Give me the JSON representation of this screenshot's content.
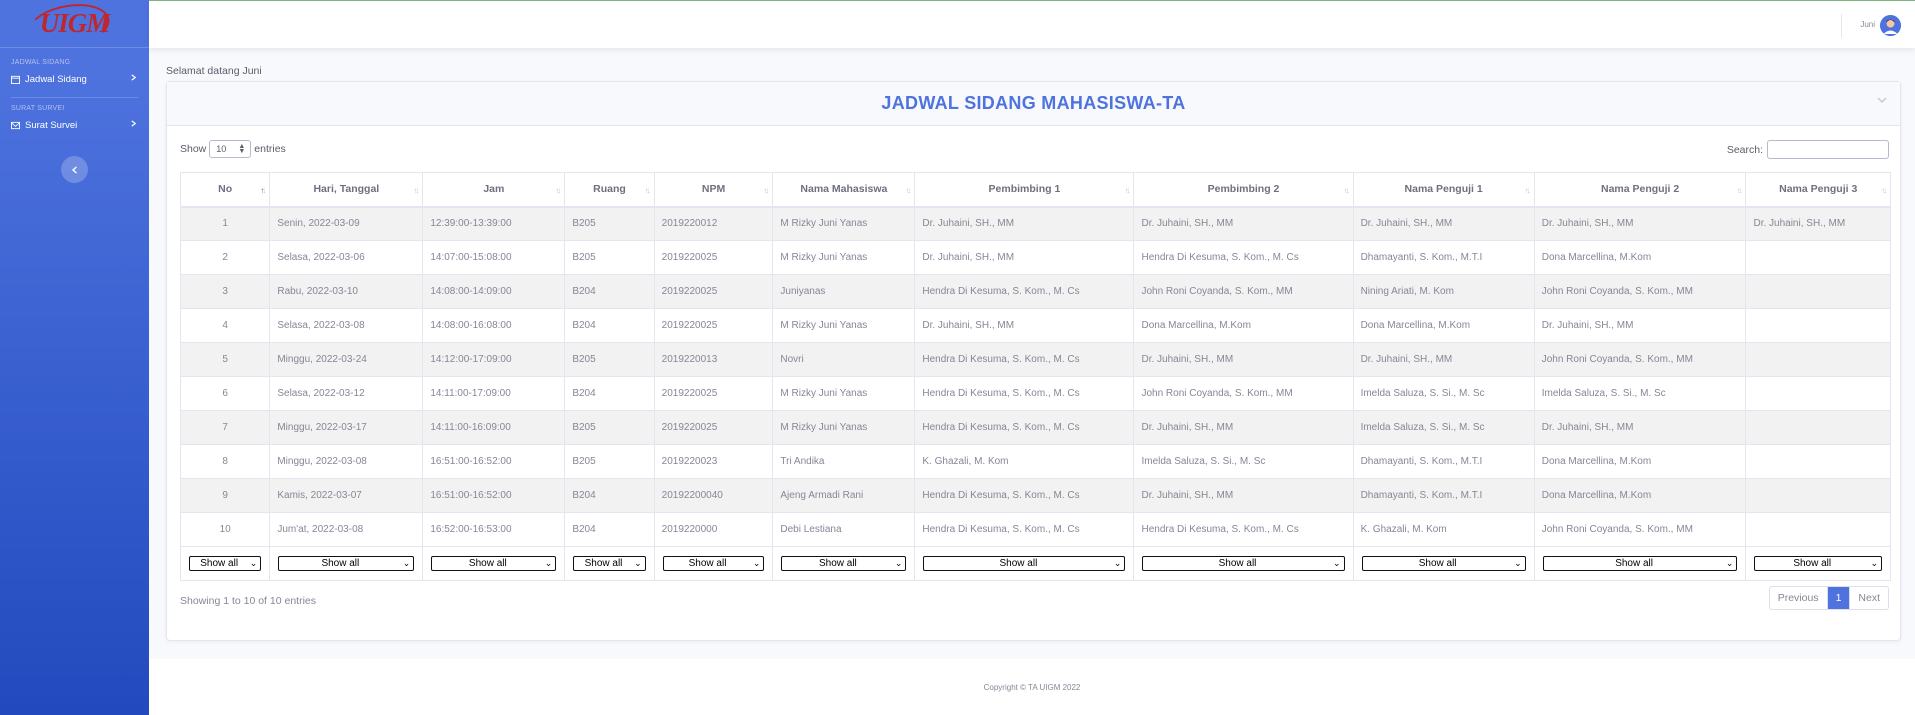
{
  "sidebar": {
    "logo": "UIGM",
    "heading_1": "JADWAL SIDANG",
    "item_1": "Jadwal Sidang",
    "heading_2": "SURAT SURVEI",
    "item_2": "Surat Survei"
  },
  "topbar": {
    "user_name": "Juni"
  },
  "welcome": "Selamat datang Juni",
  "card": {
    "title": "JADWAL SIDANG MAHASISWA-TA"
  },
  "controls": {
    "show": "Show",
    "entries_value": "10",
    "entries": "entries",
    "search_label": "Search:"
  },
  "table": {
    "headers": [
      "No",
      "Hari, Tanggal",
      "Jam",
      "Ruang",
      "NPM",
      "Nama Mahasiswa",
      "Pembimbing 1",
      "Pembimbing 2",
      "Nama Penguji 1",
      "Nama Penguji 2",
      "Nama Penguji 3"
    ],
    "rows": [
      [
        "1",
        "Senin, 2022-03-09",
        "12:39:00-13:39:00",
        "B205",
        "2019220012",
        "M Rizky Juni Yanas",
        "Dr. Juhaini, SH., MM",
        "Dr. Juhaini, SH., MM",
        "Dr. Juhaini, SH., MM",
        "Dr. Juhaini, SH., MM",
        "Dr. Juhaini, SH., MM"
      ],
      [
        "2",
        "Selasa, 2022-03-06",
        "14:07:00-15:08:00",
        "B205",
        "2019220025",
        "M Rizky Juni Yanas",
        "Dr. Juhaini, SH., MM",
        "Hendra Di Kesuma, S. Kom., M. Cs",
        "Dhamayanti, S. Kom., M.T.I",
        "Dona Marcellina, M.Kom",
        ""
      ],
      [
        "3",
        "Rabu, 2022-03-10",
        "14:08:00-14:09:00",
        "B204",
        "2019220025",
        "Juniyanas",
        "Hendra Di Kesuma, S. Kom., M. Cs",
        "John Roni Coyanda, S. Kom., MM",
        "Nining Ariati, M. Kom",
        "John Roni Coyanda, S. Kom., MM",
        ""
      ],
      [
        "4",
        "Selasa, 2022-03-08",
        "14:08:00-16:08:00",
        "B204",
        "2019220025",
        "M Rizky Juni Yanas",
        "Dr. Juhaini, SH., MM",
        "Dona Marcellina, M.Kom",
        "Dona Marcellina, M.Kom",
        "Dr. Juhaini, SH., MM",
        ""
      ],
      [
        "5",
        "Minggu, 2022-03-24",
        "14:12:00-17:09:00",
        "B205",
        "2019220013",
        "Novri",
        "Hendra Di Kesuma, S. Kom., M. Cs",
        "Dr. Juhaini, SH., MM",
        "Dr. Juhaini, SH., MM",
        "John Roni Coyanda, S. Kom., MM",
        ""
      ],
      [
        "6",
        "Selasa, 2022-03-12",
        "14:11:00-17:09:00",
        "B204",
        "2019220025",
        "M Rizky Juni Yanas",
        "Hendra Di Kesuma, S. Kom., M. Cs",
        "John Roni Coyanda, S. Kom., MM",
        "Imelda Saluza, S. Si., M. Sc",
        "Imelda Saluza, S. Si., M. Sc",
        ""
      ],
      [
        "7",
        "Minggu, 2022-03-17",
        "14:11:00-16:09:00",
        "B205",
        "2019220025",
        "M Rizky Juni Yanas",
        "Hendra Di Kesuma, S. Kom., M. Cs",
        "Dr. Juhaini, SH., MM",
        "Imelda Saluza, S. Si., M. Sc",
        "Dr. Juhaini, SH., MM",
        ""
      ],
      [
        "8",
        "Minggu, 2022-03-08",
        "16:51:00-16:52:00",
        "B205",
        "2019220023",
        "Tri Andika",
        "K. Ghazali, M. Kom",
        "Imelda Saluza, S. Si., M. Sc",
        "Dhamayanti, S. Kom., M.T.I",
        "Dona Marcellina, M.Kom",
        ""
      ],
      [
        "9",
        "Kamis, 2022-03-07",
        "16:51:00-16:52:00",
        "B204",
        "20192200040",
        "Ajeng Armadi Rani",
        "Hendra Di Kesuma, S. Kom., M. Cs",
        "Dr. Juhaini, SH., MM",
        "Dhamayanti, S. Kom., M.T.I",
        "Dona Marcellina, M.Kom",
        ""
      ],
      [
        "10",
        "Jum'at, 2022-03-08",
        "16:52:00-16:53:00",
        "B204",
        "2019220000",
        "Debi Lestiana",
        "Hendra Di Kesuma, S. Kom., M. Cs",
        "Hendra Di Kesuma, S. Kom., M. Cs",
        "K. Ghazali, M. Kom",
        "John Roni Coyanda, S. Kom., MM",
        ""
      ]
    ],
    "filter_label": "Show all"
  },
  "info": "Showing 1 to 10 of 10 entries",
  "pager": {
    "previous": "Previous",
    "current": "1",
    "next": "Next"
  },
  "footer": "Copyright © TA UIGM 2022",
  "colors": {
    "primary": "#4e73df",
    "sidebar_bottom": "#224abe",
    "logo_red": "#c0262d"
  }
}
